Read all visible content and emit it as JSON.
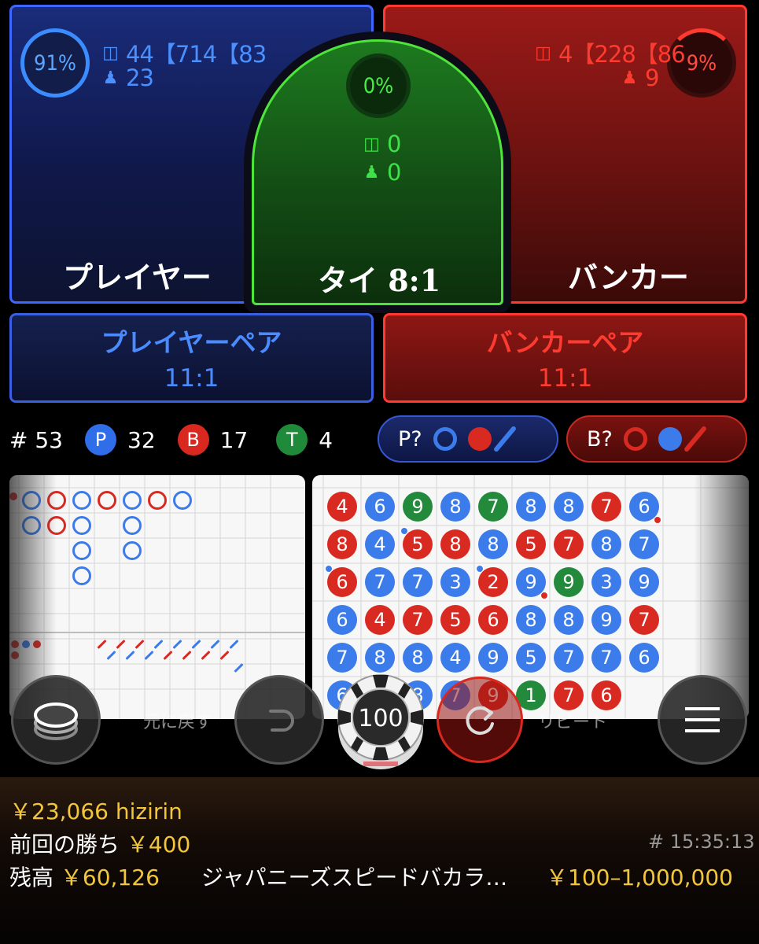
{
  "player": {
    "percent": "91%",
    "amount": "44【714【83",
    "players": "23",
    "label": "プレイヤー",
    "amount_icon": "coin-icon",
    "players_icon": "person-icon"
  },
  "tie": {
    "percent": "0%",
    "amount": "0",
    "players": "0",
    "label": "タイ 8:1"
  },
  "banker": {
    "percent": "9%",
    "amount": "4【228【86",
    "players": "9",
    "label": "バンカー"
  },
  "player_pair": {
    "label": "プレイヤーペア",
    "odds": "11:1"
  },
  "banker_pair": {
    "label": "バンカーペア",
    "odds": "11:1"
  },
  "stats": {
    "round": "# 53",
    "p_letter": "P",
    "p_count": "32",
    "b_letter": "B",
    "b_count": "17",
    "t_letter": "T",
    "t_count": "4"
  },
  "predict": {
    "player_label": "P?",
    "banker_label": "B?"
  },
  "bead_road": [
    [
      "B4",
      "P6",
      "T9",
      "P8",
      "T7",
      "P8",
      "P8",
      "B7",
      "P6bp"
    ],
    [
      "B8",
      "P4",
      "B5pp",
      "B8",
      "P8",
      "B5",
      "B7",
      "P8",
      "P7"
    ],
    [
      "B6pp",
      "P7",
      "P7",
      "P3",
      "B2pp",
      "P9bp",
      "T9",
      "P3",
      "P9"
    ],
    [
      "P6",
      "B4",
      "B7",
      "B5",
      "B6",
      "P8",
      "P8",
      "P9",
      "B7"
    ],
    [
      "P7",
      "P8",
      "P8",
      "P4",
      "P9",
      "P5",
      "P7",
      "P7",
      "P6"
    ],
    [
      "P6",
      "",
      "P8",
      "P7",
      "B9",
      "T1",
      "B7",
      "B6",
      ""
    ]
  ],
  "big_road": [
    {
      "col": 1,
      "row": 0,
      "r": "P"
    },
    {
      "col": 2,
      "row": 0,
      "r": "B"
    },
    {
      "col": 3,
      "row": 0,
      "r": "P"
    },
    {
      "col": 4,
      "row": 0,
      "r": "B"
    },
    {
      "col": 5,
      "row": 0,
      "r": "P"
    },
    {
      "col": 6,
      "row": 0,
      "r": "B"
    },
    {
      "col": 7,
      "row": 0,
      "r": "P"
    },
    {
      "col": 1,
      "row": 1,
      "r": "P"
    },
    {
      "col": 2,
      "row": 1,
      "r": "B"
    },
    {
      "col": 3,
      "row": 1,
      "r": "P"
    },
    {
      "col": 5,
      "row": 1,
      "r": "P"
    },
    {
      "col": 3,
      "row": 2,
      "r": "P"
    },
    {
      "col": 5,
      "row": 2,
      "r": "P"
    },
    {
      "col": 3,
      "row": 3,
      "r": "P"
    }
  ],
  "controls": {
    "undo_label": "元に戻す",
    "chip_value": "100",
    "repeat_label": "リピート",
    "chips_icon": "chip-stack-icon",
    "undo_icon": "undo-icon",
    "repeat_icon": "repeat-icon",
    "menu_icon": "menu-icon"
  },
  "footer": {
    "user": "￥23,066 hizirin",
    "last_win_label": "前回の勝ち",
    "last_win": "￥400",
    "balance_label": "残高",
    "balance": "￥60,126",
    "game_name": "ジャパニーズスピードバカラ…",
    "limits": "￥100–1,000,000",
    "round_time": "# 15:35:13"
  },
  "colors": {
    "player": "#3b7bea",
    "banker": "#d92a22",
    "tie": "#238a3c",
    "gold": "#f3c63a"
  }
}
